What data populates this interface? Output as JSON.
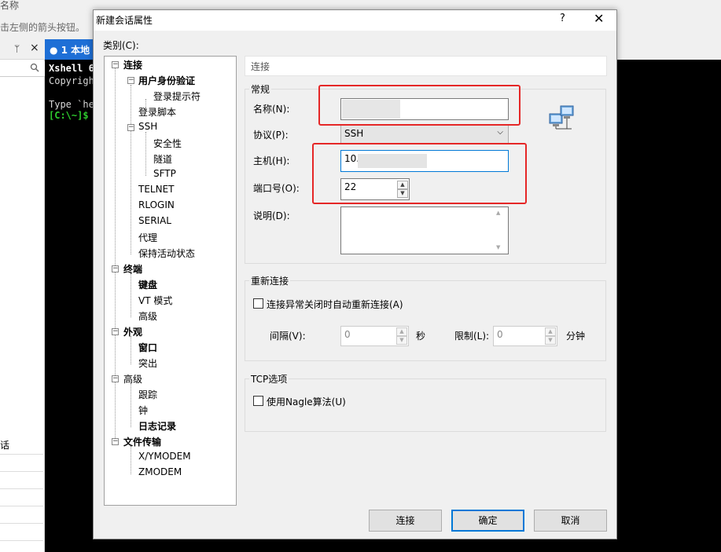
{
  "background": {
    "title_fragment": "名称",
    "hint": "击左侧的箭头按钮。",
    "pin": "ᛘ",
    "close": "×",
    "tab_label": "1 本地",
    "list_row_text": "话",
    "terminal_lines": [
      "Xshell 6",
      "Copyrigh",
      "",
      "Type `he"
    ],
    "terminal_prompt": "[C:\\~]$"
  },
  "dialog": {
    "title": "新建会话属性",
    "help": "?",
    "close": "✕",
    "category_label": "类别(C):",
    "tree": [
      {
        "label": "连接",
        "bold": true
      },
      {
        "label": "用户身份验证",
        "bold": true
      },
      {
        "label": "登录提示符",
        "bold": false
      },
      {
        "label": "登录脚本",
        "bold": false
      },
      {
        "label": "SSH",
        "bold": false
      },
      {
        "label": "安全性",
        "bold": false
      },
      {
        "label": "隧道",
        "bold": false
      },
      {
        "label": "SFTP",
        "bold": false
      },
      {
        "label": "TELNET",
        "bold": false
      },
      {
        "label": "RLOGIN",
        "bold": false
      },
      {
        "label": "SERIAL",
        "bold": false
      },
      {
        "label": "代理",
        "bold": false
      },
      {
        "label": "保持活动状态",
        "bold": false
      },
      {
        "label": "终端",
        "bold": true
      },
      {
        "label": "键盘",
        "bold": true
      },
      {
        "label": "VT 模式",
        "bold": false
      },
      {
        "label": "高级",
        "bold": false
      },
      {
        "label": "外观",
        "bold": true
      },
      {
        "label": "窗口",
        "bold": true
      },
      {
        "label": "突出",
        "bold": false
      },
      {
        "label": "高级",
        "bold": false
      },
      {
        "label": "跟踪",
        "bold": false
      },
      {
        "label": "钟",
        "bold": false
      },
      {
        "label": "日志记录",
        "bold": true
      },
      {
        "label": "文件传输",
        "bold": true
      },
      {
        "label": "X/YMODEM",
        "bold": false
      },
      {
        "label": "ZMODEM",
        "bold": false
      }
    ],
    "section_header": "连接",
    "general": {
      "title": "常规",
      "name_label": "名称(N):",
      "name_value": "",
      "protocol_label": "协议(P):",
      "protocol_value": "SSH",
      "host_label": "主机(H):",
      "host_value": "10.1",
      "port_label": "端口号(O):",
      "port_value": "22",
      "desc_label": "说明(D):",
      "desc_value": ""
    },
    "reconnect": {
      "title": "重新连接",
      "checkbox_label": "连接异常关闭时自动重新连接(A)",
      "interval_label": "间隔(V):",
      "interval_value": "0",
      "interval_unit": "秒",
      "limit_label": "限制(L):",
      "limit_value": "0",
      "limit_unit": "分钟"
    },
    "tcp": {
      "title": "TCP选项",
      "nagle_label": "使用Nagle算法(U)"
    },
    "buttons": {
      "connect": "连接",
      "ok": "确定",
      "cancel": "取消"
    }
  },
  "colors": {
    "annotation_red": "#e52727",
    "focus_blue": "#0078d7",
    "terminal_green": "#2ecc2e"
  }
}
